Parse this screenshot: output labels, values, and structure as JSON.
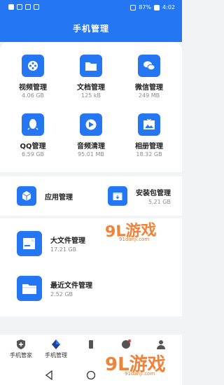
{
  "status_bar": {
    "battery": "87%",
    "time": "4:02"
  },
  "header": {
    "title": "手机管理"
  },
  "grid": [
    {
      "label": "视频管理",
      "size": "4.06 GB",
      "icon": "video-icon"
    },
    {
      "label": "文档管理",
      "size": "125 kB",
      "icon": "folder-icon"
    },
    {
      "label": "微信管理",
      "size": "249 MB",
      "icon": "wechat-icon"
    },
    {
      "label": "QQ管理",
      "size": "6.59 GB",
      "icon": "qq-icon"
    },
    {
      "label": "音频清理",
      "size": "95.01 MB",
      "icon": "audio-icon"
    },
    {
      "label": "相册管理",
      "size": "18.32 GB",
      "icon": "album-icon"
    }
  ],
  "apps": {
    "app_manage": {
      "label": "应用管理",
      "icon": "cube-icon"
    },
    "installer": {
      "label": "安装包管理",
      "size": "5.21 GB",
      "icon": "package-icon"
    }
  },
  "files": {
    "large": {
      "label": "大文件管理",
      "size": "17.21 GB",
      "icon": "file-icon"
    },
    "recent": {
      "label": "最近文件管理",
      "size": "2.52 GB",
      "icon": "folder-icon"
    }
  },
  "watermark": {
    "brand": "9L游戏",
    "site": "91danji.com"
  },
  "bottom_nav": [
    {
      "label": "手机管家",
      "icon": "shield-icon"
    },
    {
      "label": "手机管理",
      "icon": "manage-icon"
    }
  ],
  "colors": {
    "accent": "#2476f2",
    "watermark": "#f07524"
  }
}
